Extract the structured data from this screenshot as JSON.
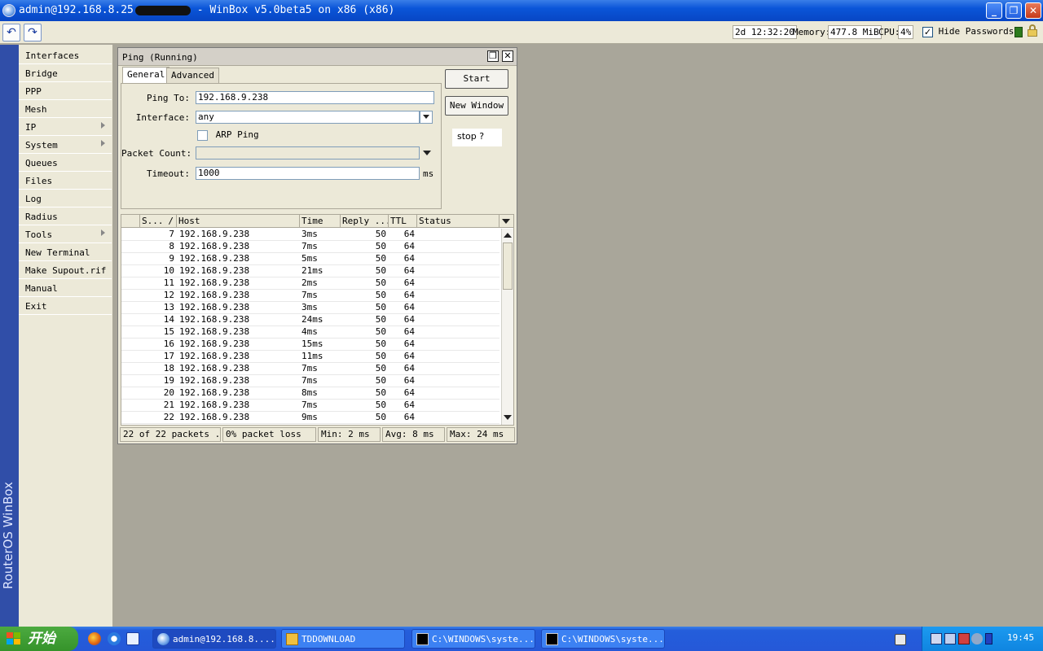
{
  "window": {
    "title_prefix": "admin@192.168.8.25",
    "title_suffix": "- WinBox v5.0beta5 on x86 (x86)",
    "minimize": "_",
    "maximize": "❐",
    "close": "✕"
  },
  "toolbar": {
    "undo": "↶",
    "redo": "↷",
    "uptime": "2d 12:32:20",
    "memory_label": "Memory:",
    "memory": "477.8 MiB",
    "cpu_label": "CPU:",
    "cpu": "4%",
    "hide_passwords_label": "Hide Passwords",
    "hide_passwords_checked": "✓"
  },
  "brand": "RouterOS WinBox",
  "sidebar": {
    "items": [
      {
        "label": "Interfaces",
        "submenu": false
      },
      {
        "label": "Bridge",
        "submenu": false
      },
      {
        "label": "PPP",
        "submenu": false
      },
      {
        "label": "Mesh",
        "submenu": false
      },
      {
        "label": "IP",
        "submenu": true
      },
      {
        "label": "System",
        "submenu": true
      },
      {
        "label": "Queues",
        "submenu": false
      },
      {
        "label": "Files",
        "submenu": false
      },
      {
        "label": "Log",
        "submenu": false
      },
      {
        "label": "Radius",
        "submenu": false
      },
      {
        "label": "Tools",
        "submenu": true
      },
      {
        "label": "New Terminal",
        "submenu": false
      },
      {
        "label": "Make Supout.rif",
        "submenu": false
      },
      {
        "label": "Manual",
        "submenu": false
      },
      {
        "label": "Exit",
        "submenu": false
      }
    ]
  },
  "ping": {
    "title": "Ping (Running)",
    "restore": "❐",
    "close": "✕",
    "tabs": [
      "General",
      "Advanced"
    ],
    "active_tab": "General",
    "form": {
      "ping_to_label": "Ping To:",
      "ping_to": "192.168.9.238",
      "interface_label": "Interface:",
      "interface": "any",
      "arp_ping_label": "ARP Ping",
      "packet_count_label": "Packet Count:",
      "packet_count": "",
      "timeout_label": "Timeout:",
      "timeout": "1000",
      "timeout_unit": "ms"
    },
    "buttons": {
      "start": "Start",
      "new_window": "New Window"
    },
    "note": "stop ?",
    "table": {
      "columns": [
        "S...",
        "Host",
        "Time",
        "Reply ...",
        "TTL",
        "Status"
      ],
      "sort_indicator": "/",
      "rows": [
        {
          "seq": "7",
          "host": "192.168.9.238",
          "time": "3ms",
          "reply": "50",
          "ttl": "64",
          "status": ""
        },
        {
          "seq": "8",
          "host": "192.168.9.238",
          "time": "7ms",
          "reply": "50",
          "ttl": "64",
          "status": ""
        },
        {
          "seq": "9",
          "host": "192.168.9.238",
          "time": "5ms",
          "reply": "50",
          "ttl": "64",
          "status": ""
        },
        {
          "seq": "10",
          "host": "192.168.9.238",
          "time": "21ms",
          "reply": "50",
          "ttl": "64",
          "status": ""
        },
        {
          "seq": "11",
          "host": "192.168.9.238",
          "time": "2ms",
          "reply": "50",
          "ttl": "64",
          "status": ""
        },
        {
          "seq": "12",
          "host": "192.168.9.238",
          "time": "7ms",
          "reply": "50",
          "ttl": "64",
          "status": ""
        },
        {
          "seq": "13",
          "host": "192.168.9.238",
          "time": "3ms",
          "reply": "50",
          "ttl": "64",
          "status": ""
        },
        {
          "seq": "14",
          "host": "192.168.9.238",
          "time": "24ms",
          "reply": "50",
          "ttl": "64",
          "status": ""
        },
        {
          "seq": "15",
          "host": "192.168.9.238",
          "time": "4ms",
          "reply": "50",
          "ttl": "64",
          "status": ""
        },
        {
          "seq": "16",
          "host": "192.168.9.238",
          "time": "15ms",
          "reply": "50",
          "ttl": "64",
          "status": ""
        },
        {
          "seq": "17",
          "host": "192.168.9.238",
          "time": "11ms",
          "reply": "50",
          "ttl": "64",
          "status": ""
        },
        {
          "seq": "18",
          "host": "192.168.9.238",
          "time": "7ms",
          "reply": "50",
          "ttl": "64",
          "status": ""
        },
        {
          "seq": "19",
          "host": "192.168.9.238",
          "time": "7ms",
          "reply": "50",
          "ttl": "64",
          "status": ""
        },
        {
          "seq": "20",
          "host": "192.168.9.238",
          "time": "8ms",
          "reply": "50",
          "ttl": "64",
          "status": ""
        },
        {
          "seq": "21",
          "host": "192.168.9.238",
          "time": "7ms",
          "reply": "50",
          "ttl": "64",
          "status": ""
        },
        {
          "seq": "22",
          "host": "192.168.9.238",
          "time": "9ms",
          "reply": "50",
          "ttl": "64",
          "status": ""
        }
      ]
    },
    "status": {
      "packets": "22 of 22 packets ...",
      "loss": "0% packet loss",
      "min": "Min: 2 ms",
      "avg": "Avg: 8 ms",
      "max": "Max: 24 ms"
    }
  },
  "taskbar": {
    "start": "开始",
    "tasks": [
      {
        "label": "admin@192.168.8....",
        "active": true,
        "icon": "winbox-icon"
      },
      {
        "label": "TDDOWNLOAD",
        "active": false,
        "icon": "folder-icon"
      },
      {
        "label": "C:\\WINDOWS\\syste...",
        "active": false,
        "icon": "console-icon"
      },
      {
        "label": "C:\\WINDOWS\\syste...",
        "active": false,
        "icon": "console-icon"
      }
    ],
    "clock": "19:45"
  },
  "colors": {
    "titlebar": "#0a55d8",
    "brand_bar": "#304ea8",
    "desktop": "#a9a69a",
    "panel": "#ece9d8",
    "taskbar": "#245edb",
    "start": "#35932a"
  }
}
